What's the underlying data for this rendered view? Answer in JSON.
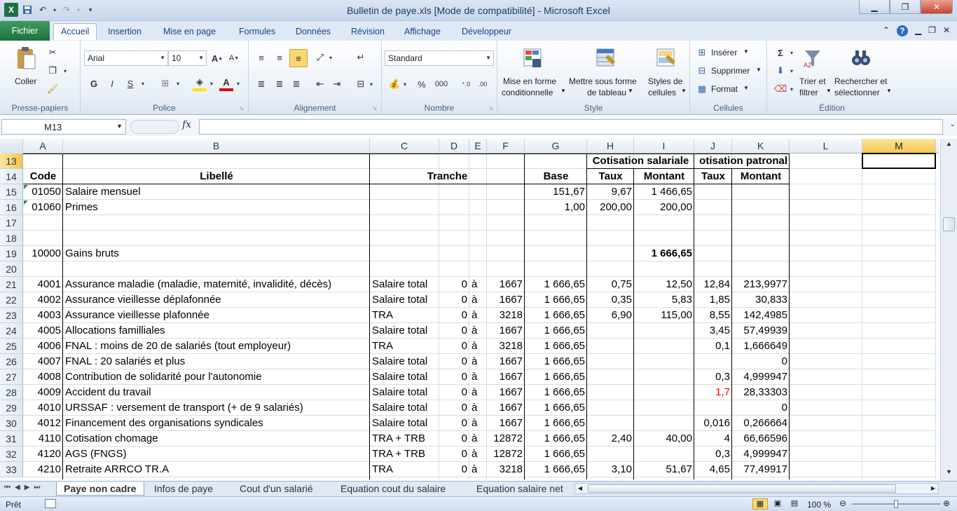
{
  "window": {
    "title": "Bulletin de paye.xls  [Mode de compatibilité]  -  Microsoft Excel",
    "logo": "X",
    "minimize": "▁",
    "restore": "❐",
    "close": "✕"
  },
  "ribbon_tabs": [
    "Fichier",
    "Accueil",
    "Insertion",
    "Mise en page",
    "Formules",
    "Données",
    "Révision",
    "Affichage",
    "Développeur"
  ],
  "ribbon": {
    "clipboard": {
      "label": "Presse-papiers",
      "paste": "Coller"
    },
    "font": {
      "label": "Police",
      "name": "Arial",
      "size": "10",
      "bold": "G",
      "italic": "I",
      "underline": "S"
    },
    "alignment": {
      "label": "Alignement"
    },
    "number": {
      "label": "Nombre",
      "format": "Standard",
      "percent": "%",
      "thousands": "000"
    },
    "style": {
      "label": "Style",
      "cond1": "Mise en forme",
      "cond2": "conditionnelle",
      "table1": "Mettre sous forme",
      "table2": "de tableau",
      "cellstyle1": "Styles de",
      "cellstyle2": "cellules"
    },
    "cells": {
      "label": "Cellules",
      "insert": "Insérer",
      "delete": "Supprimer",
      "format": "Format"
    },
    "edit": {
      "label": "Édition",
      "sort1": "Trier et",
      "sort2": "filtrer",
      "find1": "Rechercher et",
      "find2": "sélectionner"
    }
  },
  "formula_bar": {
    "namebox": "M13",
    "fx": "fx",
    "content": ""
  },
  "columns": [
    "A",
    "B",
    "C",
    "D",
    "E",
    "F",
    "G",
    "H",
    "I",
    "J",
    "K",
    "L",
    "M"
  ],
  "selected_column": "M",
  "rows": [
    {
      "n": "13",
      "cells": {
        "H": "Cotisation salariale",
        "J": "otisation patronal"
      }
    },
    {
      "n": "14",
      "cells": {
        "A": "Code",
        "B": "Libellé",
        "C": "Tranche",
        "G": "Base",
        "H": "Taux",
        "I": "Montant",
        "J": "Taux",
        "K": "Montant"
      }
    },
    {
      "n": "15",
      "cells": {
        "A": "01050",
        "B": "Salaire mensuel",
        "G": "151,67",
        "H": "9,67",
        "I": "1 466,65"
      }
    },
    {
      "n": "16",
      "cells": {
        "A": "01060",
        "B": "Primes",
        "G": "1,00",
        "H": "200,00",
        "I": "200,00"
      }
    },
    {
      "n": "17",
      "cells": {}
    },
    {
      "n": "18",
      "cells": {}
    },
    {
      "n": "19",
      "cells": {
        "A": "10000",
        "B": "Gains bruts",
        "I": "1 666,65"
      }
    },
    {
      "n": "20",
      "cells": {}
    },
    {
      "n": "21",
      "cells": {
        "A": "4001",
        "B": "Assurance maladie (maladie, maternité, invalidité, décès)",
        "C": "Salaire total",
        "D": "0",
        "E": "à",
        "F": "1667",
        "G": "1 666,65",
        "H": "0,75",
        "I": "12,50",
        "J": "12,84",
        "K": "213,9977"
      }
    },
    {
      "n": "22",
      "cells": {
        "A": "4002",
        "B": "Assurance vieillesse déplafonnée",
        "C": "Salaire total",
        "D": "0",
        "E": "à",
        "F": "1667",
        "G": "1 666,65",
        "H": "0,35",
        "I": "5,83",
        "J": "1,85",
        "K": "30,833"
      }
    },
    {
      "n": "23",
      "cells": {
        "A": "4003",
        "B": "Assurance vieillesse plafonnée",
        "C": "TRA",
        "D": "0",
        "E": "à",
        "F": "3218",
        "G": "1 666,65",
        "H": "6,90",
        "I": "115,00",
        "J": "8,55",
        "K": "142,4985"
      }
    },
    {
      "n": "24",
      "cells": {
        "A": "4005",
        "B": "Allocations familliales",
        "C": "Salaire total",
        "D": "0",
        "E": "à",
        "F": "1667",
        "G": "1 666,65",
        "J": "3,45",
        "K": "57,49939"
      }
    },
    {
      "n": "25",
      "cells": {
        "A": "4006",
        "B": "FNAL : moins de 20 de salariés (tout employeur)",
        "C": "TRA",
        "D": "0",
        "E": "à",
        "F": "3218",
        "G": "1 666,65",
        "J": "0,1",
        "K": "1,666649"
      }
    },
    {
      "n": "26",
      "cells": {
        "A": "4007",
        "B": "FNAL : 20 salariés et plus",
        "C": "Salaire total",
        "D": "0",
        "E": "à",
        "F": "1667",
        "G": "1 666,65",
        "K": "0"
      }
    },
    {
      "n": "27",
      "cells": {
        "A": "4008",
        "B": "Contribution de solidarité pour l'autonomie",
        "C": "Salaire total",
        "D": "0",
        "E": "à",
        "F": "1667",
        "G": "1 666,65",
        "J": "0,3",
        "K": "4,999947"
      }
    },
    {
      "n": "28",
      "cells": {
        "A": "4009",
        "B": "Accident du travail",
        "C": "Salaire total",
        "D": "0",
        "E": "à",
        "F": "1667",
        "G": "1 666,65",
        "J": "1,7",
        "K": "28,33303"
      }
    },
    {
      "n": "29",
      "cells": {
        "A": "4010",
        "B": "URSSAF : versement de transport (+ de 9 salariés)",
        "C": "Salaire total",
        "D": "0",
        "E": "à",
        "F": "1667",
        "G": "1 666,65",
        "K": "0"
      }
    },
    {
      "n": "30",
      "cells": {
        "A": "4012",
        "B": "Financement des organisations syndicales",
        "C": "Salaire total",
        "D": "0",
        "E": "à",
        "F": "1667",
        "G": "1 666,65",
        "J": "0,016",
        "K": "0,266664"
      }
    },
    {
      "n": "31",
      "cells": {
        "A": "4110",
        "B": "Cotisation chomage",
        "C": "TRA + TRB",
        "D": "0",
        "E": "à",
        "F": "12872",
        "G": "1 666,65",
        "H": "2,40",
        "I": "40,00",
        "J": "4",
        "K": "66,66596"
      }
    },
    {
      "n": "32",
      "cells": {
        "A": "4120",
        "B": "AGS (FNGS)",
        "C": "TRA + TRB",
        "D": "0",
        "E": "à",
        "F": "12872",
        "G": "1 666,65",
        "J": "0,3",
        "K": "4,999947"
      }
    },
    {
      "n": "33",
      "cells": {
        "A": "4210",
        "B": "Retraite ARRCO TR.A",
        "C": "TRA",
        "D": "0",
        "E": "à",
        "F": "3218",
        "G": "1 666,65",
        "H": "3,10",
        "I": "51,67",
        "J": "4,65",
        "K": "77,49917"
      }
    }
  ],
  "sheet_tabs": [
    "Paye non cadre",
    "Infos de paye",
    "Cout d'un salarié",
    "Equation cout du salaire",
    "Equation salaire net"
  ],
  "status": {
    "mode": "Prêt",
    "zoom": "100 %"
  },
  "colors": {
    "accent": "#1e7145",
    "selection": "#f5c54f",
    "red_value": "#ff0000"
  }
}
